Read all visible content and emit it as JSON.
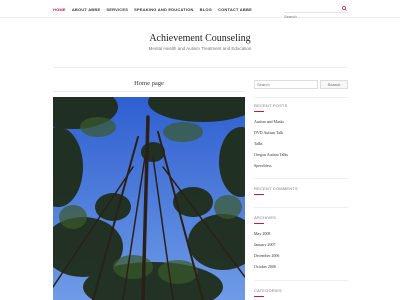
{
  "nav": {
    "items": [
      {
        "label": "HOME"
      },
      {
        "label": "ABOUT ABBE"
      },
      {
        "label": "SERVICES"
      },
      {
        "label": "SPEAKING AND EDUCATION"
      },
      {
        "label": "BLOG"
      },
      {
        "label": "CONTACT ABBE"
      }
    ],
    "search_placeholder": "Search"
  },
  "site": {
    "title": "Achievement Counseling",
    "tagline": "Mental Health and Autism Treatment and Education"
  },
  "main": {
    "page_title": "Home page"
  },
  "sidebar": {
    "search_placeholder": "Search",
    "search_button": "Search",
    "recent_posts_title": "RECENT POSTS",
    "recent_posts": [
      "Autism and Masks",
      "DVD Autism Talk",
      "Talks",
      "Oregon Autism Talks",
      "Speechless"
    ],
    "recent_comments_title": "RECENT COMMENTS",
    "archives_title": "ARCHIVES",
    "archives": [
      "May 2008",
      "January 2007",
      "December 2006",
      "October 2006"
    ],
    "categories_title": "CATEGORIES"
  },
  "colors": {
    "accent": "#c2185b",
    "sky": "#3f6fd8"
  }
}
